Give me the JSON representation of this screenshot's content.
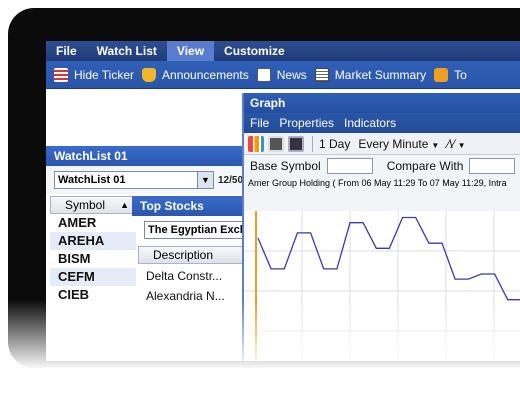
{
  "menubar": {
    "items": [
      {
        "label": "File",
        "active": false
      },
      {
        "label": "Watch List",
        "active": false
      },
      {
        "label": "View",
        "active": true
      },
      {
        "label": "Customize",
        "active": false
      }
    ]
  },
  "toolbar": {
    "items": [
      {
        "label": "Hide Ticker",
        "icon": "ticker-icon"
      },
      {
        "label": "Announcements",
        "icon": "announcement-icon"
      },
      {
        "label": "News",
        "icon": "news-icon"
      },
      {
        "label": "Market Summary",
        "icon": "market-summary-icon"
      },
      {
        "label": "To",
        "icon": "top-stocks-icon"
      }
    ]
  },
  "watchlist": {
    "title": "WatchList 01",
    "selected": "WatchList 01",
    "count": "12/50",
    "column": "Symbol",
    "symbols": [
      "AMER",
      "AREHA",
      "BISM",
      "CEFM",
      "CIEB"
    ]
  },
  "top_stocks": {
    "title": "Top Stocks",
    "exchange": "The Egyptian Exch",
    "column": "Description",
    "rows": [
      "Delta Constr...",
      "Alexandria N..."
    ]
  },
  "graph": {
    "title": "Graph",
    "menu": [
      "File",
      "Properties",
      "Indicators"
    ],
    "period": "1 Day",
    "interval": "Every Minute",
    "base_symbol_label": "Base Symbol",
    "compare_label": "Compare With",
    "caption": "Amer Group Holding ( From 06 May 11:29 To 07 May 11:29, Intra",
    "chart_data": {
      "type": "line",
      "series": [
        {
          "values": [
            2.2,
            1.6,
            1.6,
            2.3,
            2.3,
            1.6,
            1.6,
            2.5,
            2.5,
            2.0,
            2.0,
            2.6,
            2.6,
            2.1,
            2.1,
            1.4,
            1.4,
            1.5,
            1.5,
            1.0,
            1.0,
            0.8
          ]
        }
      ],
      "line_color": "#3a3aa8",
      "grid": true
    }
  }
}
